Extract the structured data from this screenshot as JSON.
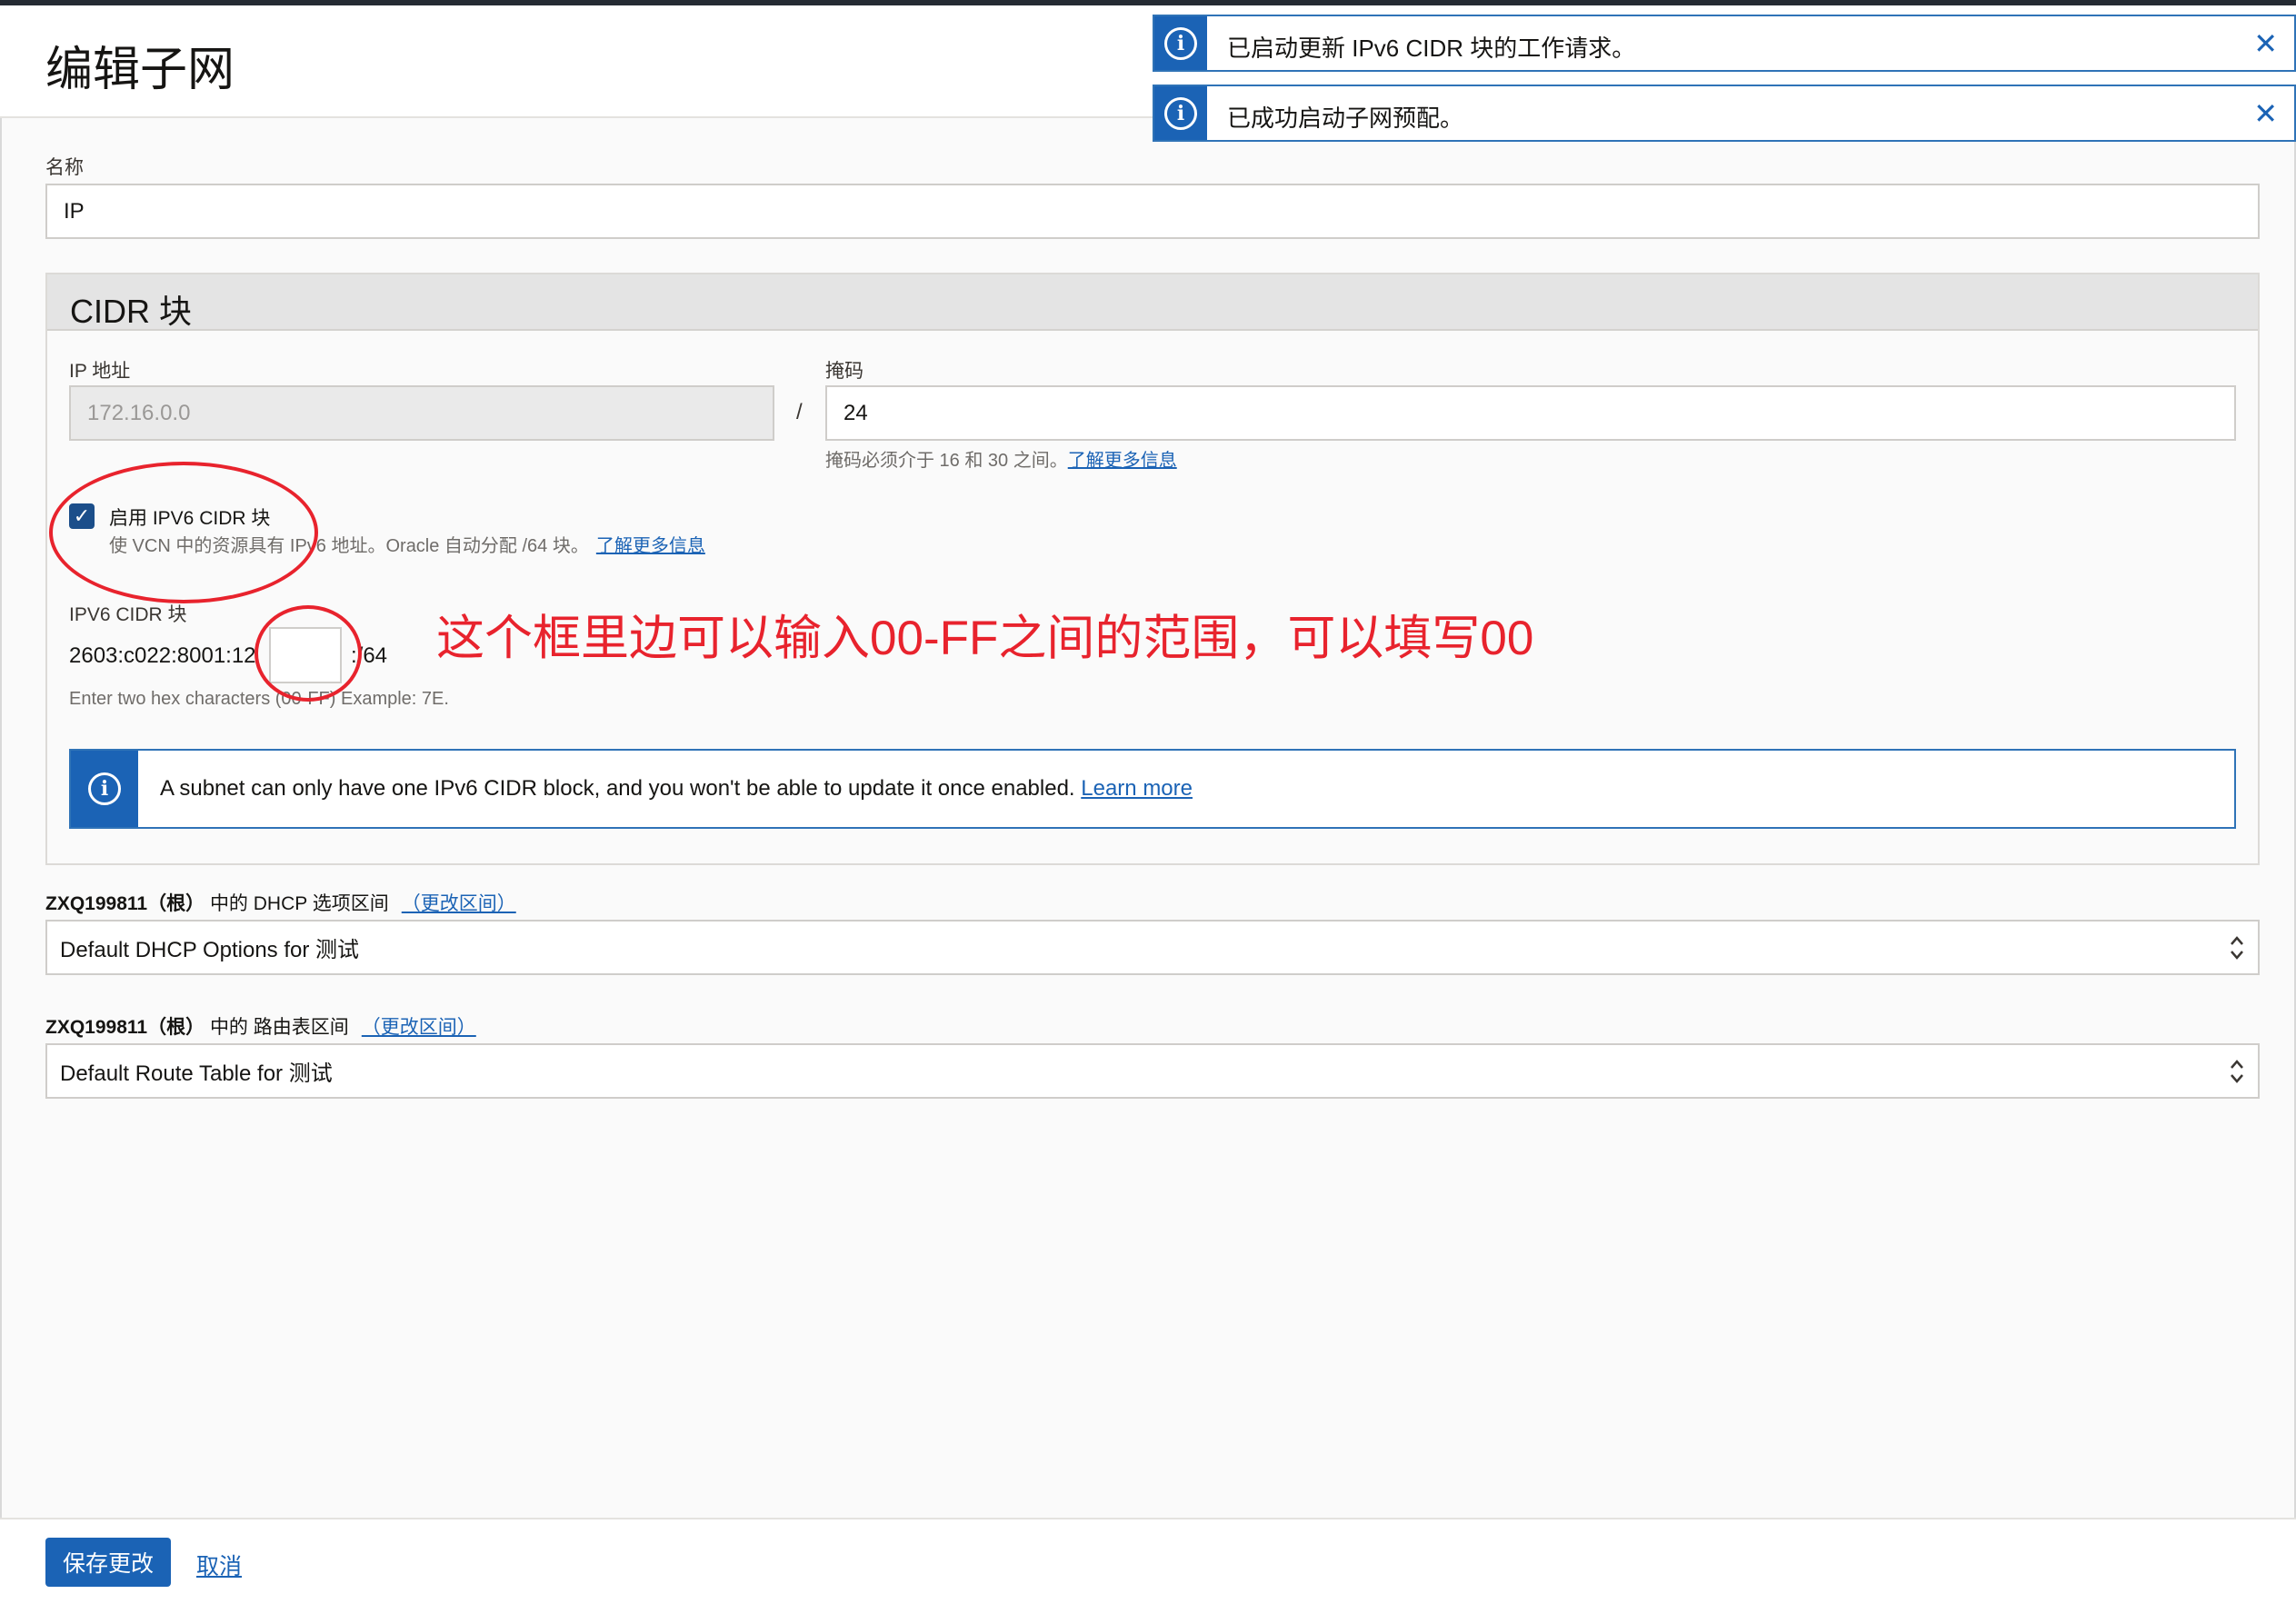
{
  "page": {
    "title": "编辑子网"
  },
  "notifications": [
    {
      "text": "已启动更新 IPv6 CIDR 块的工作请求。",
      "icon": "info-icon",
      "close": "✕"
    },
    {
      "text": "已成功启动子网预配。",
      "icon": "info-icon",
      "close": "✕"
    }
  ],
  "name_field": {
    "label": "名称",
    "value": "IP"
  },
  "cidr": {
    "title": "CIDR 块",
    "ip_label": "IP 地址",
    "ip_value": "172.16.0.0",
    "separator": "/",
    "mask_label": "掩码",
    "mask_value": "24",
    "mask_help": "掩码必须介于 16 和 30 之间。",
    "mask_help_link": "了解更多信息",
    "ipv6_enable": {
      "checked": true,
      "label": "启用 IPV6 CIDR 块",
      "description": "使 VCN 中的资源具有 IPv6 地址。Oracle 自动分配 /64 块。",
      "link": "了解更多信息"
    },
    "ipv6_label": "IPV6 CIDR 块",
    "ipv6_prefix": "2603:c022:8001:12",
    "ipv6_value": "",
    "ipv6_suffix": ":/64",
    "ipv6_help": "Enter two hex characters (00-FF) Example: 7E.",
    "alert_text": "A subnet can only have one IPv6 CIDR block, and you won't be able to update it once enabled.",
    "alert_link": "Learn more"
  },
  "dhcp": {
    "compartment": "ZXQ199811（根）",
    "label_suffix": "中的 DHCP 选项区间",
    "change_link": "（更改区间）",
    "selected": "Default DHCP Options for 测试"
  },
  "route": {
    "compartment": "ZXQ199811（根）",
    "label_suffix": "中的 路由表区间",
    "change_link": "（更改区间）",
    "selected": "Default Route Table for 测试"
  },
  "footer": {
    "save_label": "保存更改",
    "cancel_label": "取消"
  },
  "annotation": {
    "text": "这个框里边可以输入00-FF之间的范围，可以填写00",
    "color": "#e8232d"
  },
  "colors": {
    "accent": "#1b63b5",
    "annotation_red": "#e8232d",
    "topbar": "#252b33"
  }
}
